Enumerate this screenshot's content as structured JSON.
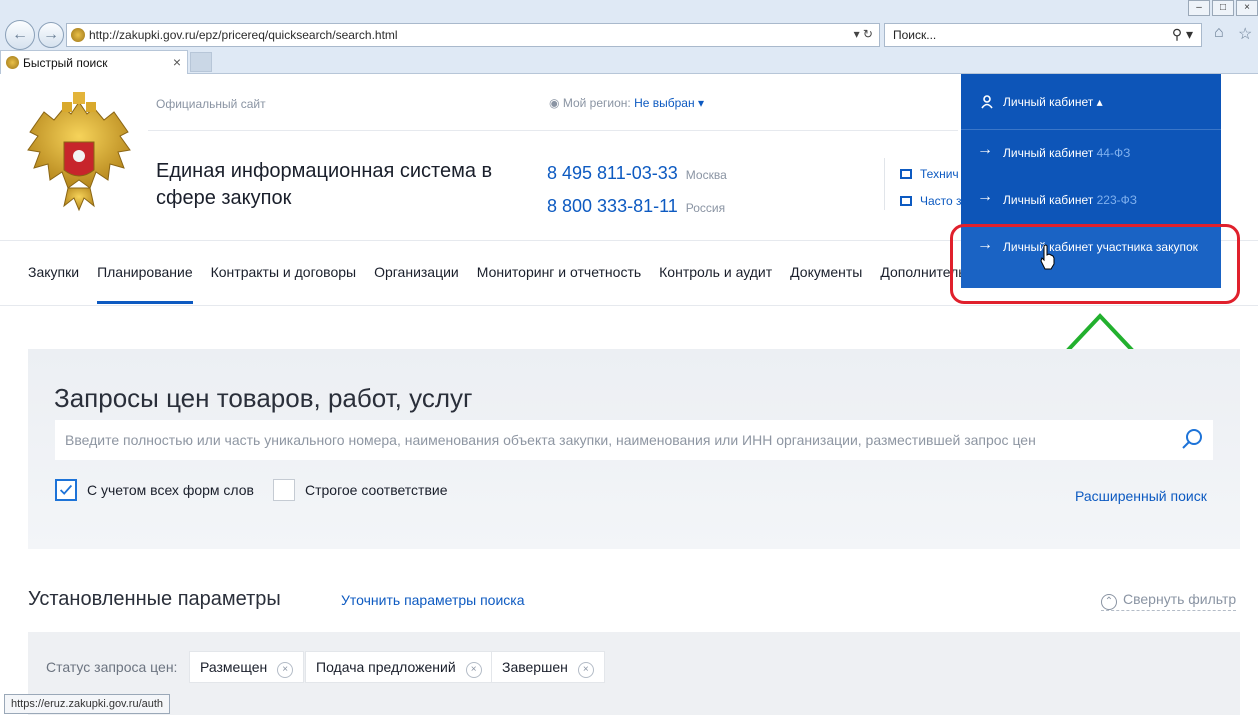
{
  "browser": {
    "url": "http://zakupki.gov.ru/epz/pricereq/quicksearch/search.html",
    "search_placeholder": "Поиск...",
    "tab_title": "Быстрый поиск",
    "status_url": "https://eruz.zakupki.gov.ru/auth"
  },
  "header": {
    "official": "Официальный сайт",
    "region_label": "Мой регион:",
    "region_value": "Не выбран",
    "site_title": "Единая информационная система в сфере закупок",
    "phones": [
      {
        "number": "8 495 811-03-33",
        "city": "Москва"
      },
      {
        "number": "8 800 333-81-11",
        "city": "Россия"
      }
    ],
    "help_links": [
      "Технич",
      "Часто з"
    ]
  },
  "menu": {
    "items": [
      "Закупки",
      "Планирование",
      "Контракты и договоры",
      "Организации",
      "Мониторинг и отчетность",
      "Контроль и аудит",
      "Документы",
      "Дополнительна"
    ]
  },
  "dropdown": {
    "title": "Личный кабинет",
    "items": [
      {
        "label": "Личный кабинет",
        "suffix": "44-ФЗ"
      },
      {
        "label": "Личный кабинет",
        "suffix": "223-ФЗ"
      },
      {
        "label": "Личный кабинет участника закупок",
        "suffix": ""
      }
    ]
  },
  "search": {
    "title": "Запросы цен товаров, работ, услуг",
    "placeholder": "Введите полностью или часть уникального номера, наименования объекта закупки, наименования или ИНН организации, разместившей запрос цен",
    "checkbox1": "С учетом всех форм слов",
    "checkbox2": "Строгое соответствие",
    "advanced": "Расширенный поиск"
  },
  "params": {
    "title": "Установленные параметры",
    "refine": "Уточнить параметры поиска",
    "collapse": "Свернуть фильтр",
    "status_label": "Статус запроса цен:",
    "chips": [
      "Размещен",
      "Подача предложений",
      "Завершен"
    ]
  },
  "colors": {
    "accent": "#0d5ac1",
    "dropdown_bg": "#0d55b8",
    "highlight": "#e0202c",
    "arrow": "#22b02e"
  }
}
